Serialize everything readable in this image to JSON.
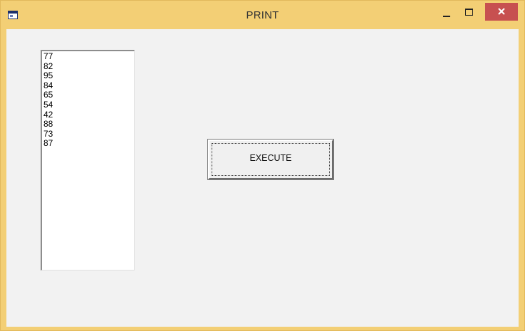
{
  "window": {
    "title": "PRINT",
    "icon": "app-window-icon",
    "controls": {
      "minimize_icon": "minimize-icon",
      "maximize_icon": "maximize-icon",
      "close_icon": "close-icon"
    },
    "colors": {
      "frame": "#f3cf75",
      "client": "#f2f2f2",
      "close_button": "#c75050"
    }
  },
  "listbox": {
    "items": [
      "77",
      "82",
      "95",
      "84",
      "65",
      "54",
      "42",
      "88",
      "73",
      "87"
    ]
  },
  "execute_button": {
    "label": "EXECUTE"
  }
}
